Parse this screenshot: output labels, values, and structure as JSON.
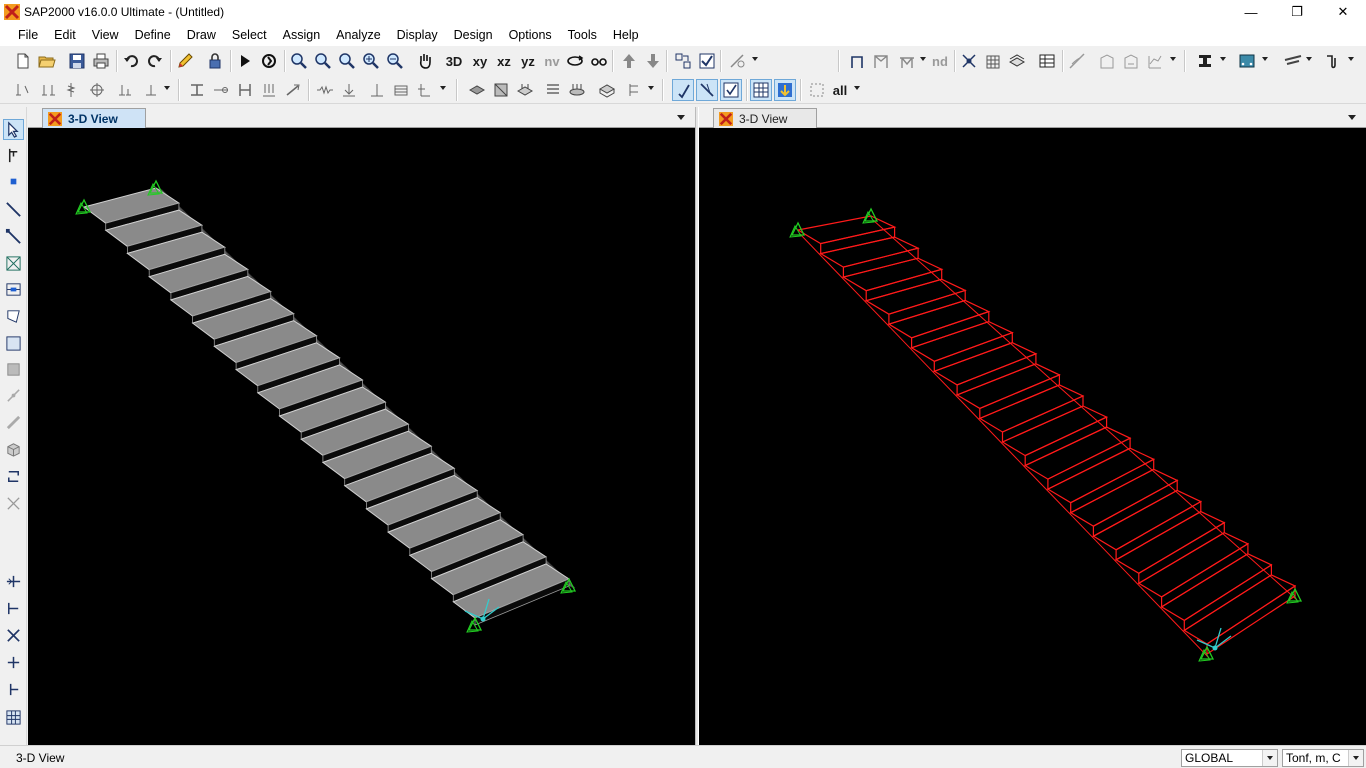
{
  "window": {
    "title": "SAP2000 v16.0.0 Ultimate  - (Untitled)",
    "minimize_glyph": "—",
    "restore_glyph": "❐",
    "close_glyph": "✕"
  },
  "menu": [
    "File",
    "Edit",
    "View",
    "Define",
    "Draw",
    "Select",
    "Assign",
    "Analyze",
    "Display",
    "Design",
    "Options",
    "Tools",
    "Help"
  ],
  "toolbar": {
    "view_xy": "xy",
    "view_xz": "xz",
    "view_yz": "yz",
    "view_nv": "nv",
    "view_3d": "3D",
    "label_nd": "nd",
    "select_all": "all"
  },
  "panes": [
    {
      "tab_label": "3-D View",
      "active": true,
      "render": "extruded",
      "stair_color": "#8a8a8a"
    },
    {
      "tab_label": "3-D View",
      "active": false,
      "render": "wireframe",
      "stair_color": "#ff1a1a"
    }
  ],
  "colors": {
    "support": "#22cc22",
    "axes": "#33cccc",
    "background": "#000000"
  },
  "status": {
    "view_name": "3-D View",
    "coord_system": "GLOBAL",
    "units": "Tonf, m, C"
  }
}
